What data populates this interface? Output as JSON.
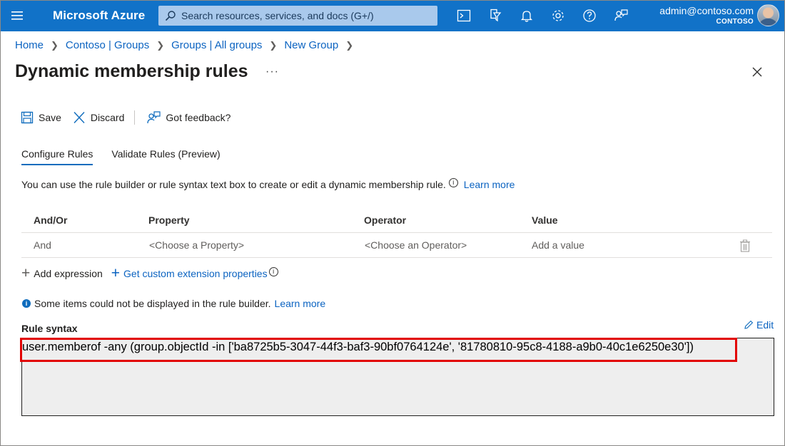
{
  "topbar": {
    "brand": "Microsoft Azure",
    "search_placeholder": "Search resources, services, and docs (G+/)",
    "user_email": "admin@contoso.com",
    "user_org": "CONTOSO",
    "icons": [
      "cloud-shell-icon",
      "directory-filter-icon",
      "bell-icon",
      "gear-icon",
      "help-icon",
      "feedback-icon"
    ]
  },
  "breadcrumb": [
    "Home",
    "Contoso | Groups",
    "Groups | All groups",
    "New Group"
  ],
  "page": {
    "title": "Dynamic membership rules",
    "more": "···"
  },
  "commands": {
    "save": "Save",
    "discard": "Discard",
    "feedback": "Got feedback?"
  },
  "tabs": [
    "Configure Rules",
    "Validate Rules (Preview)"
  ],
  "description": {
    "text": "You can use the rule builder or rule syntax text box to create or edit a dynamic membership rule.",
    "link": "Learn more"
  },
  "rule_table": {
    "headers": [
      "And/Or",
      "Property",
      "Operator",
      "Value"
    ],
    "row": [
      "And",
      "<Choose a Property>",
      "<Choose an Operator>",
      "Add a value"
    ]
  },
  "actions": {
    "add_expression": "Add expression",
    "custom_ext": "Get custom extension properties"
  },
  "notice": {
    "text": "Some items could not be displayed in the rule builder.",
    "link": "Learn more"
  },
  "syntax": {
    "label": "Rule syntax",
    "edit": "Edit",
    "value": "user.memberof -any (group.objectId -in ['ba8725b5-3047-44f3-baf3-90bf0764124e', '81780810-95c8-4188-a9b0-40c1e6250e30'])"
  },
  "colors": {
    "topbar": "#1172c8",
    "link": "#0b63c1",
    "highlight": "#e20000"
  }
}
